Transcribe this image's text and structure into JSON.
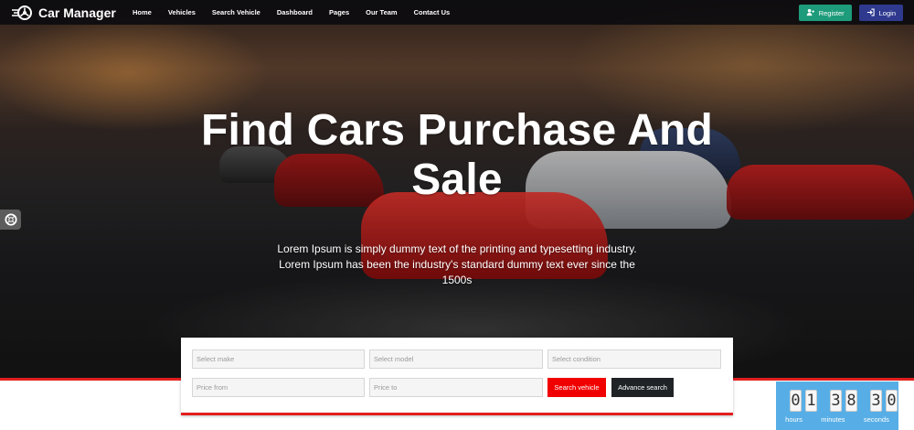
{
  "navbar": {
    "brand": "Car Manager",
    "menu": [
      "Home",
      "Vehicles",
      "Search Vehicle",
      "Dashboard",
      "Pages",
      "Our Team",
      "Contact Us"
    ],
    "actions": {
      "register": "Register",
      "login": "Login"
    }
  },
  "hero": {
    "title_line1": "Find Cars Purchase And",
    "title_line2": "Sale",
    "subtitle": "Lorem Ipsum is simply dummy text of the printing and typesetting industry. Lorem Ipsum has been the industry's standard dummy text ever since the 1500s"
  },
  "search": {
    "make_placeholder": "Select make",
    "model_placeholder": "Select model",
    "condition_placeholder": "Select condition",
    "price_from_placeholder": "Price from",
    "price_to_placeholder": "Price to",
    "search_label": "Search vehicle",
    "advance_label": "Advance search"
  },
  "countdown": {
    "hours_digits": [
      "0",
      "1"
    ],
    "minutes_digits": [
      "3",
      "8"
    ],
    "seconds_digits": [
      "3",
      "0"
    ],
    "labels": {
      "hours": "hours",
      "minutes": "minutes",
      "seconds": "seconds"
    }
  },
  "colors": {
    "accent_red": "#e21f1f",
    "register_green": "#1e9b7a",
    "login_blue": "#2f3a8f",
    "countdown_blue": "#57aee6"
  },
  "icons": {
    "brand": "steering-wheel-icon",
    "register": "user-plus-icon",
    "login": "sign-in-icon",
    "float": "life-ring-icon"
  }
}
